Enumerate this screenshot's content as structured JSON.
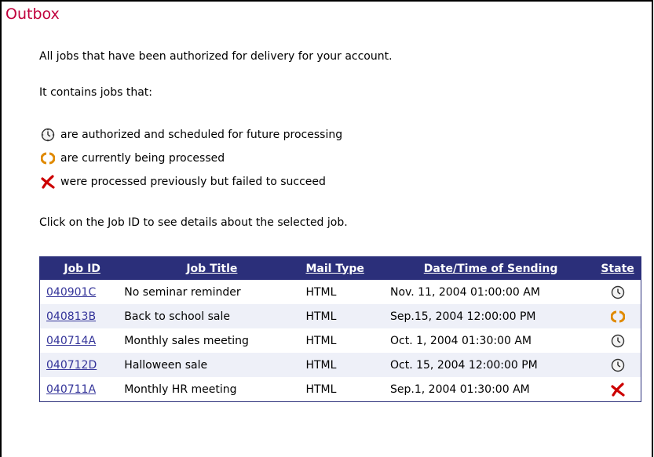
{
  "page": {
    "title": "Outbox",
    "intro": "All jobs that have been authorized for delivery for your account.",
    "contains": "It contains jobs that:",
    "legend": [
      {
        "icon": "clock-icon",
        "text": "are authorized and scheduled for future processing"
      },
      {
        "icon": "processing-icon",
        "text": "are currently being processed"
      },
      {
        "icon": "failed-x-icon",
        "text": "were processed previously but failed to succeed"
      }
    ],
    "instruction": "Click on the Job ID to see details about the selected job."
  },
  "table": {
    "headers": {
      "job_id": "Job ID",
      "job_title": "Job Title",
      "mail_type": "Mail Type",
      "date_time": "Date/Time of Sending",
      "state": "State"
    },
    "rows": [
      {
        "job_id": "040901C",
        "job_title": "No seminar reminder",
        "mail_type": "HTML",
        "date_time": "Nov. 11, 2004 01:00:00 AM",
        "state": "clock-icon"
      },
      {
        "job_id": "040813B",
        "job_title": "Back to school sale",
        "mail_type": "HTML",
        "date_time": "Sep.15, 2004 12:00:00 PM",
        "state": "processing-icon"
      },
      {
        "job_id": "040714A",
        "job_title": "Monthly sales meeting",
        "mail_type": "HTML",
        "date_time": "Oct. 1, 2004 01:30:00 AM",
        "state": "clock-icon"
      },
      {
        "job_id": "040712D",
        "job_title": "Halloween sale",
        "mail_type": "HTML",
        "date_time": "Oct. 15, 2004 12:00:00 PM",
        "state": "clock-icon"
      },
      {
        "job_id": "040711A",
        "job_title": "Monthly HR meeting",
        "mail_type": "HTML",
        "date_time": "Sep.1, 2004 01:30:00 AM",
        "state": "failed-x-icon"
      }
    ]
  },
  "colors": {
    "title": "#c0003c",
    "header_bg": "#2b2f7a",
    "link": "#333399",
    "row_alt": "#eef0f8",
    "processing": "#e08a00",
    "failed": "#cc0000"
  }
}
